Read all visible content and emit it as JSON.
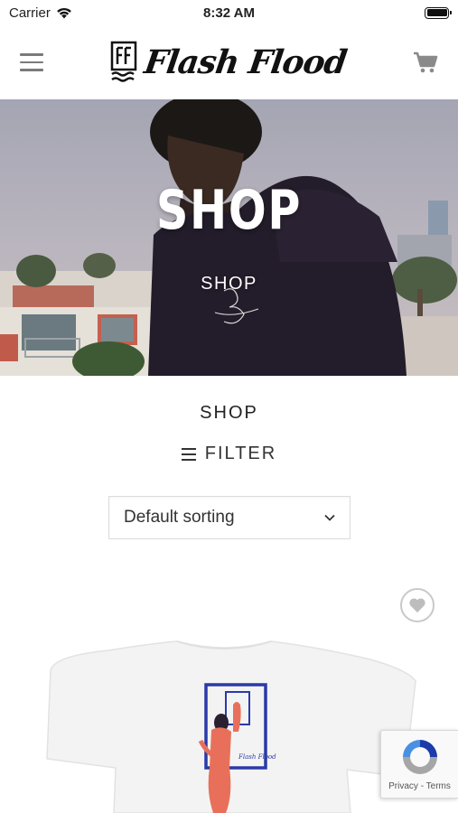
{
  "status_bar": {
    "carrier": "Carrier",
    "time": "8:32 AM"
  },
  "header": {
    "logo_text": "Flash Flood",
    "menu_icon": "hamburger-icon",
    "cart_icon": "cart-icon"
  },
  "hero": {
    "title": "SHOP",
    "breadcrumb": "SHOP"
  },
  "main": {
    "heading": "SHOP",
    "filter_label": "FILTER",
    "sort": {
      "selected": "Default sorting",
      "options": [
        "Default sorting"
      ]
    }
  },
  "recaptcha": {
    "privacy": "Privacy",
    "separator": " - ",
    "terms": "Terms"
  },
  "colors": {
    "accent_blue": "#2a3aa8",
    "figure_coral": "#e8705a",
    "icon_gray": "#7a7a7a"
  }
}
